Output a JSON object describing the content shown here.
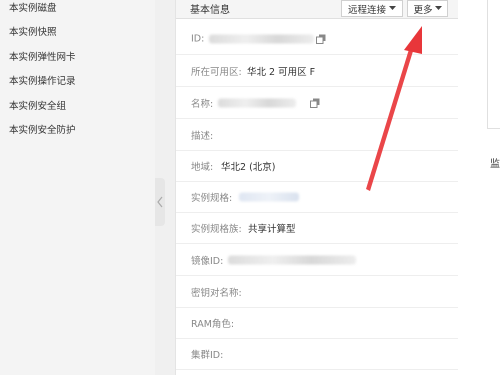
{
  "sidebar": {
    "items": [
      {
        "label": "本实例磁盘"
      },
      {
        "label": "本实例快照"
      },
      {
        "label": "本实例弹性网卡"
      },
      {
        "label": "本实例操作记录"
      },
      {
        "label": "本实例安全组"
      },
      {
        "label": "本实例安全防护"
      }
    ]
  },
  "panel": {
    "title": "基本信息",
    "remote_connect_label": "远程连接",
    "more_label": "更多",
    "fields": [
      {
        "label": "ID:",
        "value": ""
      },
      {
        "label": "所在可用区:",
        "value": "华北 2 可用区 F"
      },
      {
        "label": "名称:",
        "value": ""
      },
      {
        "label": "描述:",
        "value": ""
      },
      {
        "label": "地域:",
        "value": "华北2 (北京)"
      },
      {
        "label": "实例规格:",
        "value": ""
      },
      {
        "label": "实例规格族:",
        "value": "共享计算型"
      },
      {
        "label": "镜像ID:",
        "value": ""
      },
      {
        "label": "密钥对名称:",
        "value": ""
      },
      {
        "label": "RAM角色:",
        "value": ""
      },
      {
        "label": "集群ID:",
        "value": ""
      }
    ]
  },
  "right": {
    "partial_char": "监"
  },
  "colors": {
    "annotation_arrow": "#e8363a"
  }
}
